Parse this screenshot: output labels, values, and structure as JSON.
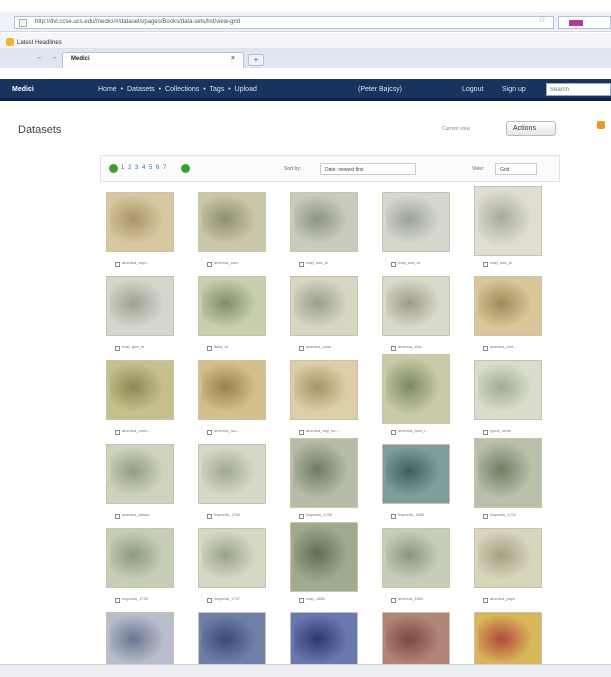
{
  "browser": {
    "url": "http://dvl.ccse.ucs.edu/medici/#/datasets/pages/Books/data-sets/list/view-grid",
    "bookmark": "Latest Headlines",
    "tab_title": "Medici",
    "nav_arrows": "← →",
    "tab_close": "×",
    "new_tab": "+",
    "star": "☆"
  },
  "navbar": {
    "brand": "Medici",
    "links": [
      "Home",
      "Datasets",
      "Collections",
      "Tags",
      "Upload"
    ],
    "separator": "•",
    "user": "(Peter Bajcsy)",
    "logout": "Logout",
    "signup": "Sign up",
    "search_placeholder": "Search"
  },
  "page": {
    "title": "Datasets",
    "current_view": "Current view",
    "actions_button": "Actions"
  },
  "toolbar": {
    "pages": "1 2 3 4 5 6 7",
    "sort_label": "Sort by:",
    "sort_value": "Date: newest first",
    "view_label": "View:",
    "view_value": "Grid"
  },
  "datasets": [
    {
      "label": "america_sepl...",
      "color": "#d8c8a0",
      "accent": "#a99468"
    },
    {
      "label": "america_caro...",
      "color": "#cbc6a8",
      "accent": "#8d8f70"
    },
    {
      "label": "map_usa_st",
      "color": "#c9cbbd",
      "accent": "#8c9585"
    },
    {
      "label": "map_usa_st",
      "color": "#d6d8cd",
      "accent": "#9da397"
    },
    {
      "label": "map_usa_st",
      "color": "#e0ded3",
      "accent": "#a8aa9e"
    },
    {
      "label": "map_gen_ar",
      "color": "#d5d6cc",
      "accent": "#9ea393"
    },
    {
      "label": "italia_ar",
      "color": "#c7cfae",
      "accent": "#7f8d66"
    },
    {
      "label": "america_cons...",
      "color": "#d6d6c2",
      "accent": "#99a08a"
    },
    {
      "label": "america_stra...",
      "color": "#d8dacc",
      "accent": "#a09a85"
    },
    {
      "label": "america_nort...",
      "color": "#d9c79a",
      "accent": "#a08a56"
    },
    {
      "label": "america_merc...",
      "color": "#c6bf8e",
      "accent": "#8f8756"
    },
    {
      "label": "america_occ...",
      "color": "#d2bf8c",
      "accent": "#9a8050"
    },
    {
      "label": "america_sep_ne...",
      "color": "#dccea6",
      "accent": "#a89468"
    },
    {
      "label": "america_boni_r...",
      "color": "#c9cba8",
      "accent": "#7c8a5e"
    },
    {
      "label": "typus_orbis",
      "color": "#d9ddcb",
      "accent": "#a1ab92"
    },
    {
      "label": "america_tabula",
      "color": "#cfd3bd",
      "accent": "#919d83"
    },
    {
      "label": "hispania_1700",
      "color": "#d6d9c8",
      "accent": "#a1a893"
    },
    {
      "label": "hispania_1705",
      "color": "#b6bca8",
      "accent": "#6f7b65"
    },
    {
      "label": "hispania_1685",
      "color": "#7f9d9b",
      "accent": "#3f5f5f"
    },
    {
      "label": "hispania_1702",
      "color": "#b9c1ac",
      "accent": "#6f7e64"
    },
    {
      "label": "hispania_1730",
      "color": "#c6cfb6",
      "accent": "#8d9a7e"
    },
    {
      "label": "hispania_1707",
      "color": "#d6d8c4",
      "accent": "#9aa38a"
    },
    {
      "label": "map_1660",
      "color": "#9fab8e",
      "accent": "#5f6f52"
    },
    {
      "label": "america_1600",
      "color": "#c6ceb9",
      "accent": "#8a9780"
    },
    {
      "label": "america_pays",
      "color": "#d7d5ba",
      "accent": "#a4a082"
    },
    {
      "label": "",
      "color": "#b7bdcb",
      "accent": "#6a7690"
    },
    {
      "label": "",
      "color": "#6f80a8",
      "accent": "#3a4a78"
    },
    {
      "label": "",
      "color": "#6a78b0",
      "accent": "#2c3970"
    },
    {
      "label": "",
      "color": "#b18577",
      "accent": "#7a4b3e"
    },
    {
      "label": "",
      "color": "#d8b75a",
      "accent": "#b2483a"
    }
  ]
}
